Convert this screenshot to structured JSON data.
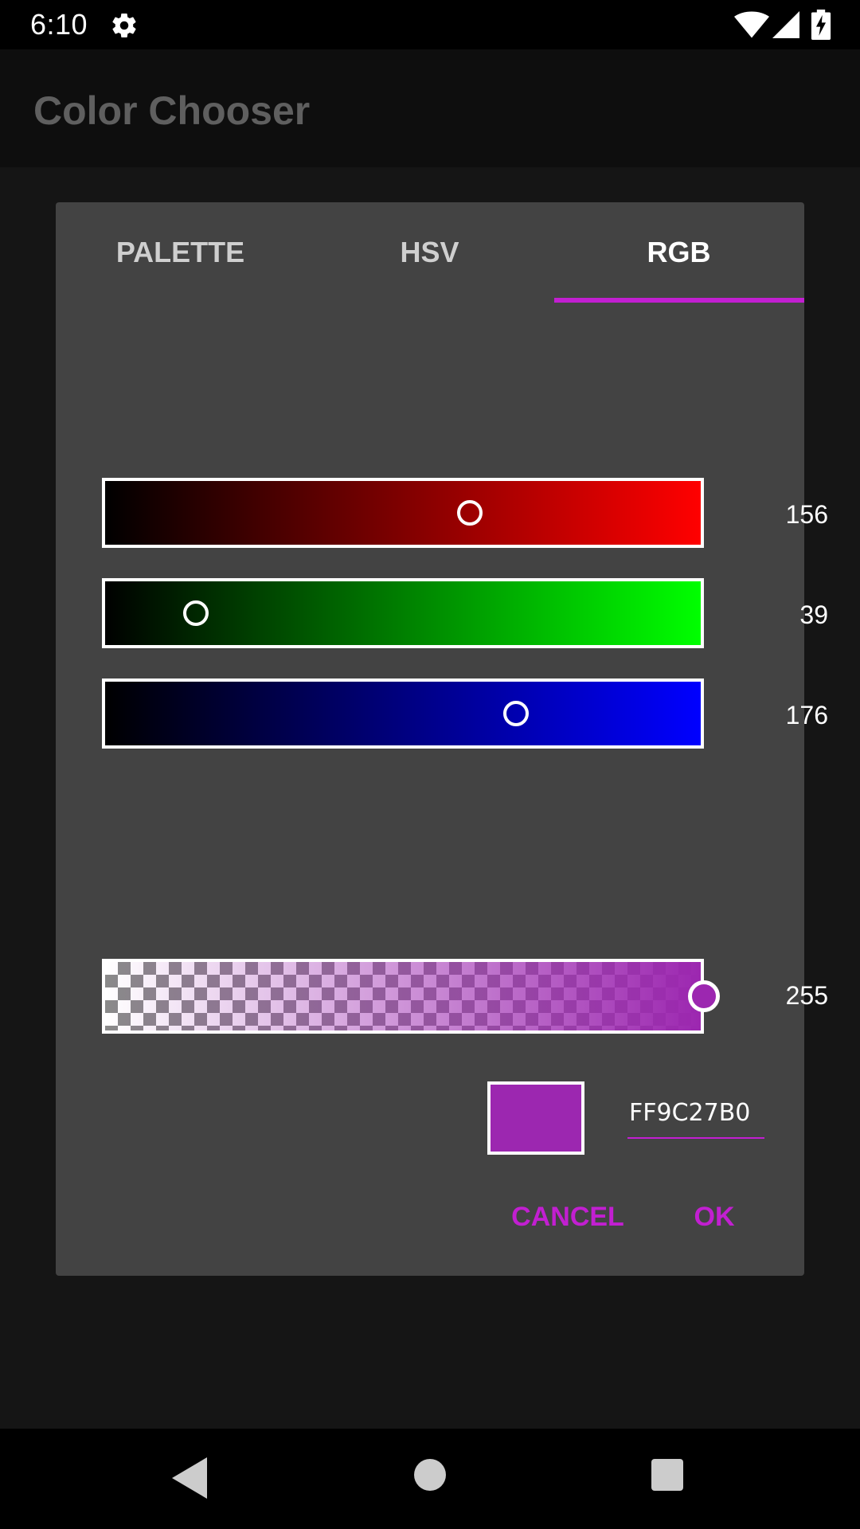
{
  "status_bar": {
    "time": "6:10"
  },
  "app_bar": {
    "title": "Color Chooser"
  },
  "dialog": {
    "tabs": [
      {
        "label": "PALETTE",
        "active": false
      },
      {
        "label": "HSV",
        "active": false
      },
      {
        "label": "RGB",
        "active": true
      }
    ],
    "sliders": [
      {
        "channel": "red",
        "value": "156",
        "fraction": 0.612,
        "end_color": "#ff0000"
      },
      {
        "channel": "green",
        "value": "39",
        "fraction": 0.153,
        "end_color": "#00ff00"
      },
      {
        "channel": "blue",
        "value": "176",
        "fraction": 0.69,
        "end_color": "#0000ff"
      }
    ],
    "alpha": {
      "value": "255",
      "fraction": 1.0
    },
    "preview_color": "#9c27b0",
    "hex_value": "FF9C27B0",
    "buttons": {
      "cancel": "CANCEL",
      "ok": "OK"
    }
  },
  "colors": {
    "accent": "#c21fd1",
    "dialog_bg": "#434343",
    "screen_bg": "#151515"
  }
}
